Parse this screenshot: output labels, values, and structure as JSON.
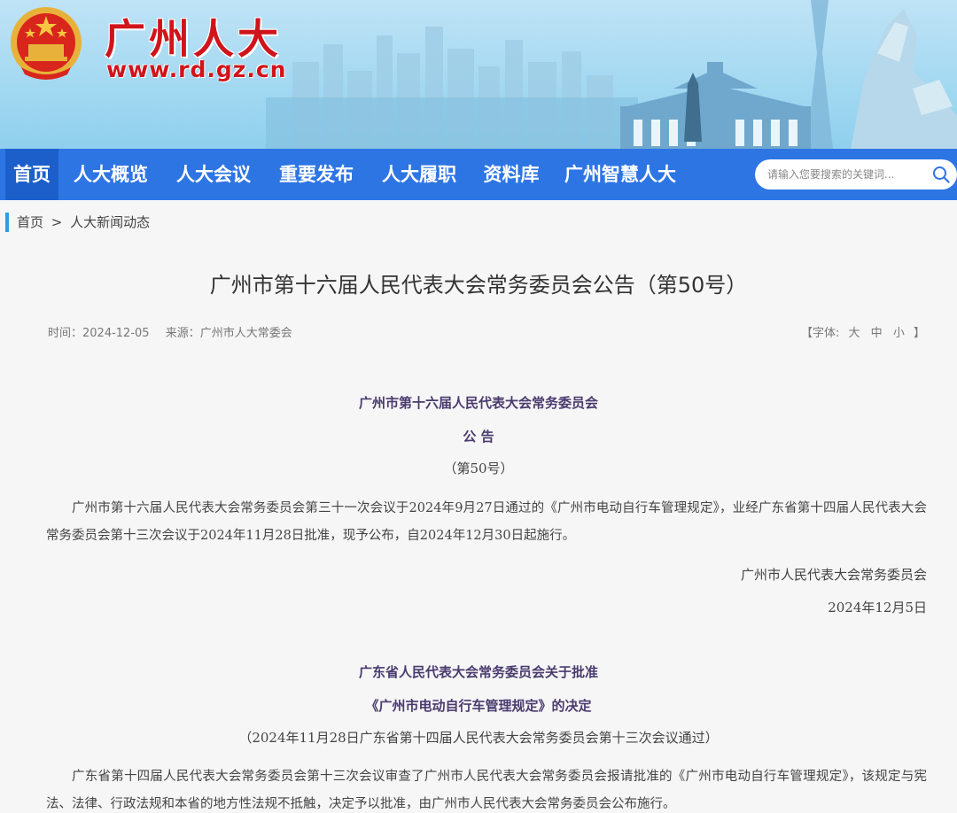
{
  "site": {
    "name": "广州人大",
    "url": "www.rd.gz.cn"
  },
  "nav": {
    "items": [
      "首页",
      "人大概览",
      "人大会议",
      "重要发布",
      "人大履职",
      "资料库",
      "广州智慧人大"
    ],
    "search_placeholder": "请输入您要搜索的关键词..."
  },
  "breadcrumb": {
    "home": "首页",
    "sep": ">",
    "current": "人大新闻动态"
  },
  "article": {
    "title": "广州市第十六届人民代表大会常务委员会公告（第50号）",
    "time_label": "时间：2024-12-05",
    "source_label": "来源：广州市人大常委会",
    "font_size": {
      "open": "【字体:",
      "large": "大",
      "medium": "中",
      "small": "小",
      "close": "】"
    }
  },
  "body": {
    "notice_org": "广州市第十六届人民代表大会常务委员会",
    "notice_word": "公 告",
    "notice_no": "（第50号）",
    "notice_para": "广州市第十六届人民代表大会常务委员会第三十一次会议于2024年9月27日通过的《广州市电动自行车管理规定》，业经广东省第十四届人民代表大会常务委员会第十三次会议于2024年11月28日批准，现予公布，自2024年12月30日起施行。",
    "sign_org": "广州市人民代表大会常务委员会",
    "sign_date": "2024年12月5日",
    "decision_title1": "广东省人民代表大会常务委员会关于批准",
    "decision_title2": "《广州市电动自行车管理规定》的决定",
    "decision_note": "（2024年11月28日广东省第十四届人民代表大会常务委员会第十三次会议通过）",
    "decision_para": "广东省第十四届人民代表大会常务委员会第十三次会议审查了广州市人民代表大会常务委员会报请批准的《广州市电动自行车管理规定》，该规定与宪法、法律、行政法规和本省的地方性法规不抵触，决定予以批准，由广州市人民代表大会常务委员会公布施行。"
  }
}
